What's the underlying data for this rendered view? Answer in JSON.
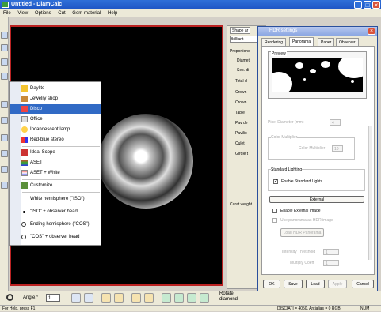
{
  "window": {
    "title": "Untitled - DiamCalc"
  },
  "menu": [
    "File",
    "View",
    "Options",
    "Cut",
    "Gem material",
    "Help"
  ],
  "context_menu": {
    "items": [
      {
        "label": "Daylite"
      },
      {
        "label": "Jewelry shop"
      },
      {
        "label": "Disco",
        "selected": true
      },
      {
        "label": "Office"
      },
      {
        "label": "Incandescent lamp"
      },
      {
        "label": "Red-blue stereo"
      },
      {
        "label": "Ideal Scope"
      },
      {
        "label": "ASET"
      },
      {
        "label": "ASET + White"
      },
      {
        "label": "Customize ..."
      },
      {
        "label": "White hemisphere (\"ISO\")"
      },
      {
        "label": "\"ISO\" + observer head"
      },
      {
        "label": "Ending hemisphere (\"COS\")"
      },
      {
        "label": "\"COS\" + observer head"
      }
    ]
  },
  "right_panel": {
    "tab": "Shape ar",
    "shape": "Brilliant",
    "proportions_label": "Proportions",
    "rows": [
      "Diamet",
      "Sec. di",
      "Total d",
      "Crown",
      "Crown",
      "Table",
      "Pav de",
      "Pavilio",
      "Culet",
      "Girdle t"
    ],
    "carat_label": "Carat weight"
  },
  "dialog": {
    "title": "HDR settings",
    "close": "×",
    "tabs": [
      "Rendering",
      "Panorama",
      "Paper",
      "Observer"
    ],
    "active_tab": "Panorama",
    "preview_label": "Preview",
    "pixel_diameter_label": "Pixel Diameter (mm)",
    "pixel_diameter_value": "4",
    "color_multiplier_group": "Color Multiplier",
    "color_multiplier_label": "Color Multiplier",
    "color_multiplier_value": "10",
    "standard_lighting_group": "Standard Lighting",
    "enable_standard_lights_label": "Enable Standard Lights",
    "enable_standard_lights_checked": true,
    "external_label": "External",
    "enable_external_image_label": "Enable External Image",
    "use_panorama_label": "Use panorama as HDR image",
    "load_panorama_label": "Load HDR Panorama",
    "intensity_threshold_label": "Intensity Threshold",
    "intensity_threshold_value": "1",
    "multiply_coeff_label": "Multiply Coeff",
    "multiply_coeff_value": "1",
    "buttons": [
      "OK",
      "Save",
      "Load",
      "Apply",
      "Cancel"
    ]
  },
  "bottom_bar": {
    "angle_label": "Angle,°",
    "angle_value": "1",
    "rotate_label": "Rotate:",
    "rotate_value": "diamond"
  },
  "status_bar": {
    "left": "For Help, press F1",
    "right": "DISCIATI = 4050, Antialias = 0 RGB",
    "mode": "NUM"
  }
}
